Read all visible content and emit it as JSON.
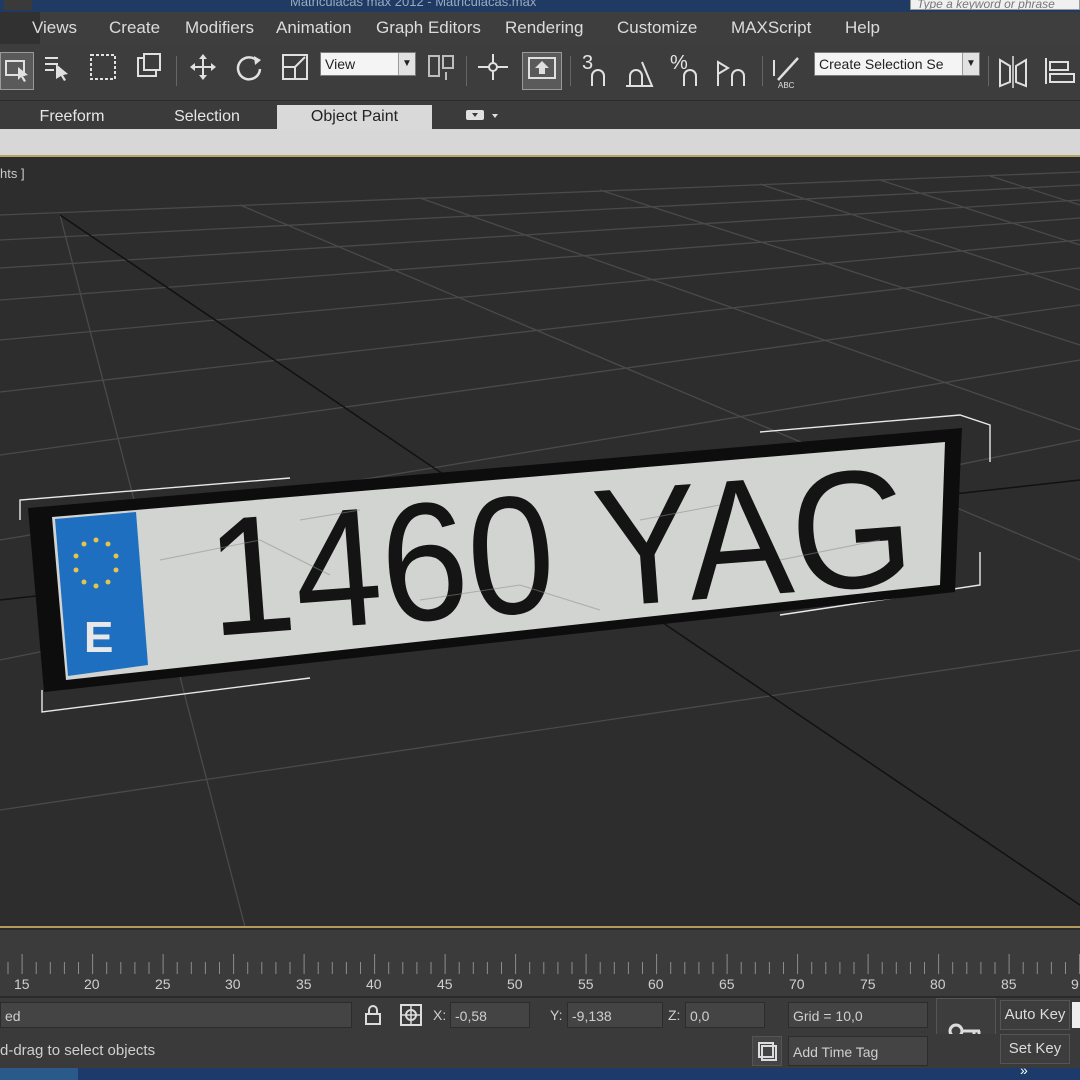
{
  "window": {
    "title": "Matriculacas max 2012 - Matriculacas.max",
    "help_search_placeholder": "Type a keyword or phrase"
  },
  "menu": {
    "items": [
      "Views",
      "Create",
      "Modifiers",
      "Animation",
      "Graph Editors",
      "Rendering",
      "Customize",
      "MAXScript",
      "Help"
    ]
  },
  "toolbar": {
    "reference_coord": "View",
    "named_selection": "Create Selection Se",
    "snap_label": "3",
    "angle_snap_label": "%"
  },
  "ribbon": {
    "tabs": [
      "Freeform",
      "Selection",
      "Object Paint"
    ],
    "active_tab": "Object Paint"
  },
  "viewport": {
    "label": "hts ]",
    "plate": {
      "text": "1460 YAG",
      "country_code": "E",
      "eu_band_color": "#1e6fc0"
    }
  },
  "timeline": {
    "ticks": [
      "15",
      "20",
      "25",
      "30",
      "35",
      "40",
      "45",
      "50",
      "55",
      "60",
      "65",
      "70",
      "75",
      "80",
      "85",
      "9"
    ]
  },
  "status": {
    "selection_info": "ed",
    "prompt": "d-drag to select objects",
    "x_label": "X:",
    "x_value": "-0,58",
    "y_label": "Y:",
    "y_value": "-9,138",
    "z_label": "Z:",
    "z_value": "0,0",
    "grid": "Grid = 10,0",
    "add_time_tag": "Add Time Tag",
    "auto_key": "Auto Key",
    "set_key": "Set Key"
  },
  "colors": {
    "accent_border": "#b49a5c",
    "viewport_bg": "#2d2d2d"
  }
}
